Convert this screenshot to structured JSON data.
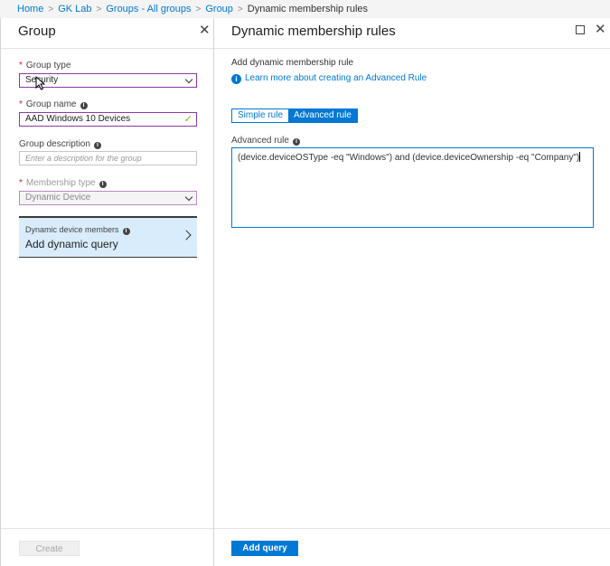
{
  "breadcrumb": {
    "items": [
      "Home",
      "GK Lab",
      "Groups - All groups",
      "Group"
    ],
    "current": "Dynamic membership rules"
  },
  "left_panel": {
    "title": "Group",
    "group_type": {
      "label": "Group type",
      "value": "Security"
    },
    "group_name": {
      "label": "Group name",
      "value": "AAD Windows 10 Devices"
    },
    "group_description": {
      "label": "Group description",
      "placeholder": "Enter a description for the group"
    },
    "membership_type": {
      "label": "Membership type",
      "value": "Dynamic Device"
    },
    "dynamic_members": {
      "label": "Dynamic device members",
      "action": "Add dynamic query"
    },
    "create_label": "Create"
  },
  "right_panel": {
    "title": "Dynamic membership rules",
    "subtitle": "Add dynamic membership rule",
    "learn_more": "Learn more about creating an Advanced Rule",
    "tabs": [
      "Simple rule",
      "Advanced rule"
    ],
    "active_tab": "Advanced rule",
    "advanced_rule_label": "Advanced rule",
    "advanced_rule_value": "(device.deviceOSType -eq \"Windows\") and (device.deviceOwnership -eq \"Company\")",
    "add_query_label": "Add query"
  },
  "colors": {
    "accent": "#0078d4",
    "focus_border": "#8a3ba0",
    "selected_card": "#d9ecfb",
    "required": "#e81123"
  }
}
